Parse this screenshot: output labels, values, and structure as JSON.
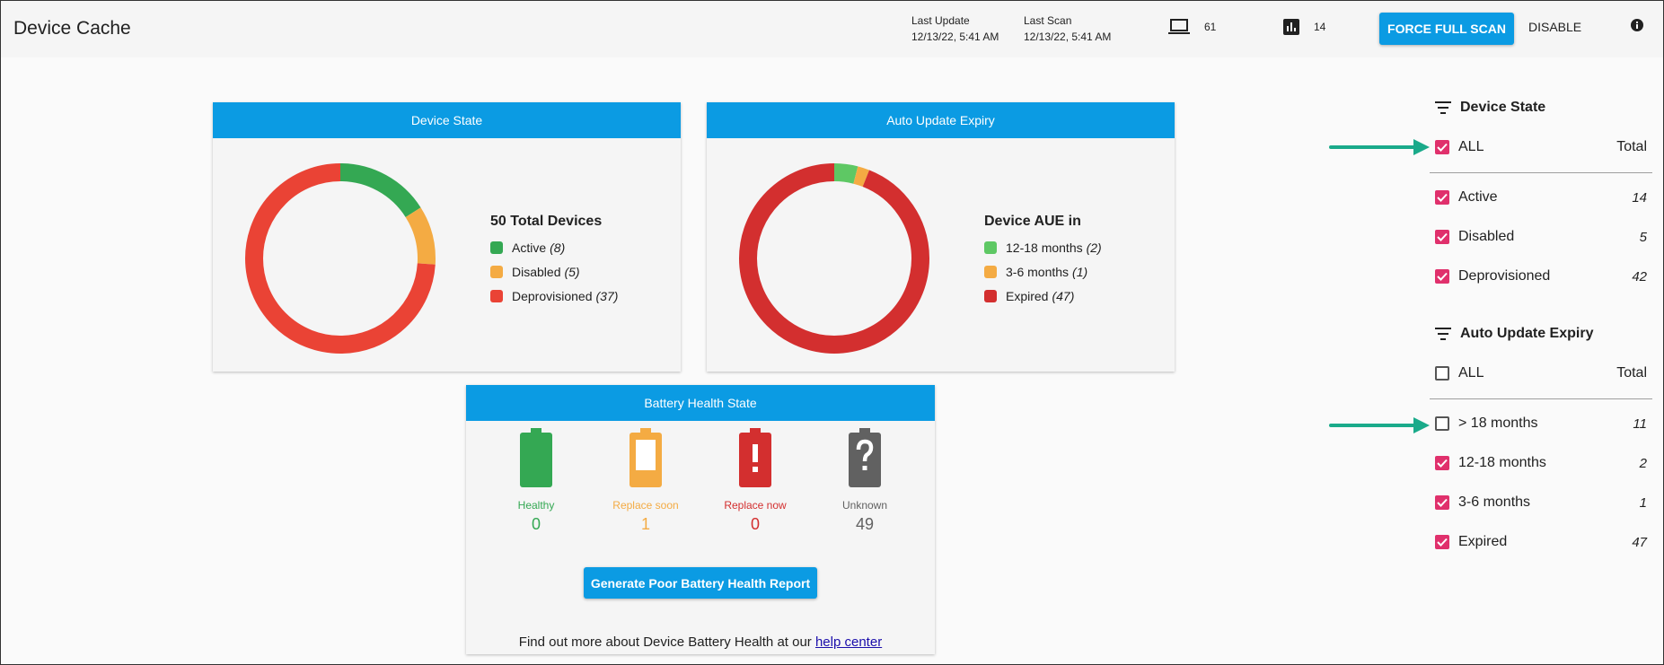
{
  "header": {
    "title": "Device Cache",
    "last_update_label": "Last Update",
    "last_update_value": "12/13/22, 5:41 AM",
    "last_scan_label": "Last Scan",
    "last_scan_value": "12/13/22, 5:41 AM",
    "devices_count": "61",
    "reports_count": "14",
    "force_scan_label": "FORCE FULL SCAN",
    "disable_label": "DISABLE",
    "icons": [
      "laptop-icon",
      "bar-chart-icon",
      "info-icon"
    ]
  },
  "device_state_card": {
    "title": "Device State",
    "legend_title": "50 Total Devices",
    "items": [
      {
        "label": "Active",
        "count": "(8)",
        "value": 8,
        "color": "#34a853"
      },
      {
        "label": "Disabled",
        "count": "(5)",
        "value": 5,
        "color": "#f4ab43"
      },
      {
        "label": "Deprovisioned",
        "count": "(37)",
        "value": 37,
        "color": "#ea4335"
      }
    ]
  },
  "aue_card": {
    "title": "Auto Update Expiry",
    "legend_title": "Device AUE in",
    "items": [
      {
        "label": "12-18 months",
        "count": "(2)",
        "value": 2,
        "color": "#5ec864"
      },
      {
        "label": "3-6 months",
        "count": "(1)",
        "value": 1,
        "color": "#f4ab43"
      },
      {
        "label": "Expired",
        "count": "(47)",
        "value": 47,
        "color": "#d32f2f"
      }
    ]
  },
  "battery_card": {
    "title": "Battery Health State",
    "items": [
      {
        "label": "Healthy",
        "value": "0",
        "color": "#34a853",
        "icon": "battery-full-icon"
      },
      {
        "label": "Replace soon",
        "value": "1",
        "color": "#f4ab43",
        "icon": "battery-empty-icon"
      },
      {
        "label": "Replace now",
        "value": "0",
        "color": "#d32f2f",
        "icon": "battery-alert-icon"
      },
      {
        "label": "Unknown",
        "value": "49",
        "color": "#616161",
        "icon": "battery-unknown-icon"
      }
    ],
    "report_button": "Generate Poor Battery Health Report",
    "help_text": "Find out more about Device Battery Health at our ",
    "help_link": "help center"
  },
  "filters": {
    "device_state": {
      "title": "Device State",
      "all_label": "ALL",
      "total_label": "Total",
      "all_checked": true,
      "rows": [
        {
          "label": "Active",
          "count": "14",
          "checked": true
        },
        {
          "label": "Disabled",
          "count": "5",
          "checked": true
        },
        {
          "label": "Deprovisioned",
          "count": "42",
          "checked": true
        }
      ]
    },
    "aue": {
      "title": "Auto Update Expiry",
      "all_label": "ALL",
      "total_label": "Total",
      "all_checked": false,
      "rows": [
        {
          "label": "> 18 months",
          "count": "11",
          "checked": false
        },
        {
          "label": "12-18 months",
          "count": "2",
          "checked": true
        },
        {
          "label": "3-6 months",
          "count": "1",
          "checked": true
        },
        {
          "label": "Expired",
          "count": "47",
          "checked": true
        }
      ]
    },
    "colors": {
      "checked": "#e0306c",
      "accent": "#0b9be3",
      "arrow": "#1aaa8a"
    }
  }
}
